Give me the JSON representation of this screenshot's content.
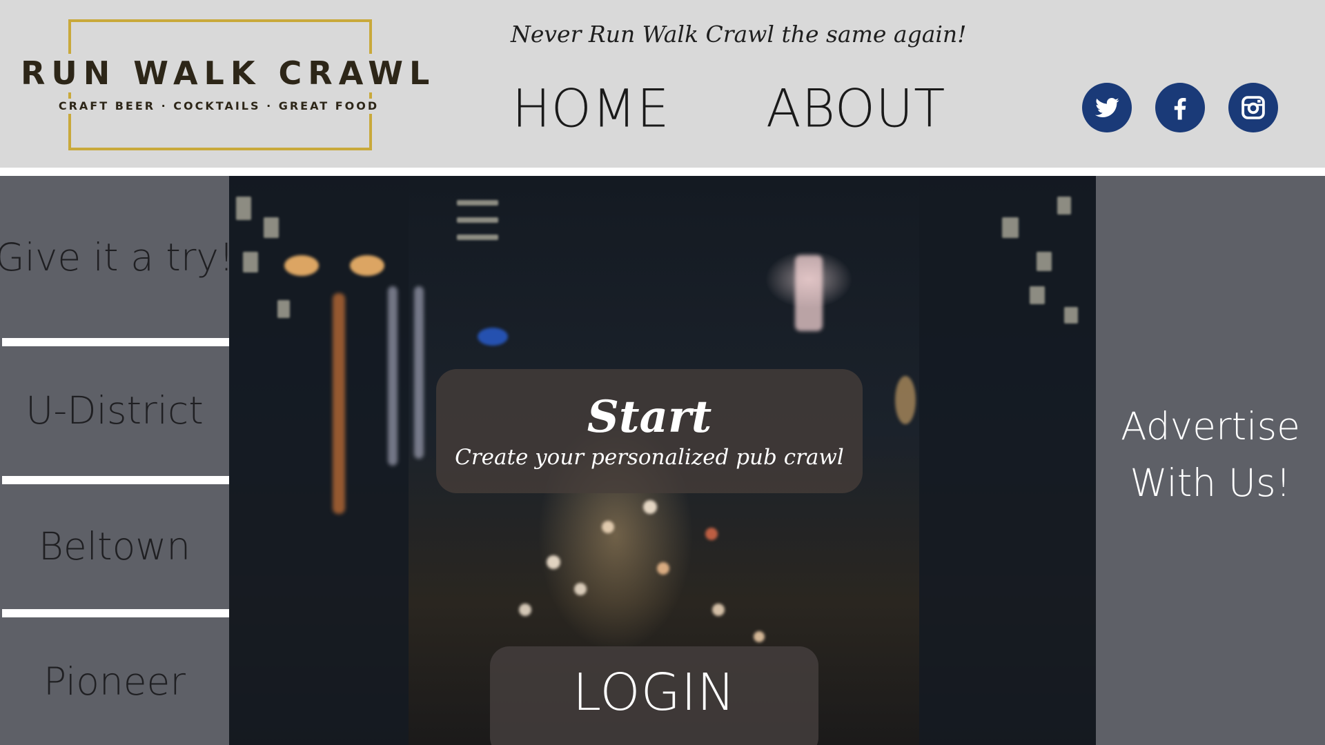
{
  "header": {
    "logo": {
      "title": "RUN WALK CRAWL",
      "subtitle": "CRAFT BEER · COCKTAILS · GREAT FOOD",
      "frame_color": "#c9a93b"
    },
    "tagline": "Never Run Walk Crawl the same again!",
    "nav": {
      "home": "HOME",
      "about": "ABOUT"
    },
    "social": [
      {
        "name": "twitter-icon",
        "color": "#1a3a78"
      },
      {
        "name": "facebook-icon",
        "color": "#1a3a78"
      },
      {
        "name": "instagram-icon",
        "color": "#1a3a78"
      }
    ]
  },
  "sidebar": {
    "items": [
      {
        "label": "Give it a try!"
      },
      {
        "label": "U-District"
      },
      {
        "label": "Beltown"
      },
      {
        "label": "Pioneer"
      }
    ]
  },
  "hero": {
    "start": {
      "title": "Start",
      "subtitle": "Create your personalized pub crawl"
    },
    "login": "LOGIN"
  },
  "ad": {
    "line1": "Advertise",
    "line2": "With Us!"
  }
}
